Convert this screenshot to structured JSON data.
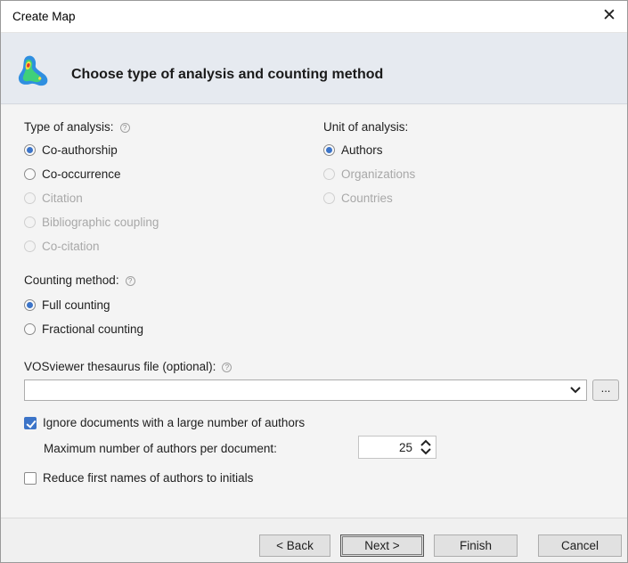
{
  "window": {
    "title": "Create Map",
    "close_glyph": "✕"
  },
  "header": {
    "title": "Choose type of analysis and counting method",
    "icon": "density-map-icon"
  },
  "type_of_analysis": {
    "label": "Type of analysis:",
    "options": [
      {
        "label": "Co-authorship",
        "selected": true,
        "enabled": true
      },
      {
        "label": "Co-occurrence",
        "selected": false,
        "enabled": true
      },
      {
        "label": "Citation",
        "selected": false,
        "enabled": false
      },
      {
        "label": "Bibliographic coupling",
        "selected": false,
        "enabled": false
      },
      {
        "label": "Co-citation",
        "selected": false,
        "enabled": false
      }
    ]
  },
  "unit_of_analysis": {
    "label": "Unit of analysis:",
    "options": [
      {
        "label": "Authors",
        "selected": true,
        "enabled": true
      },
      {
        "label": "Organizations",
        "selected": false,
        "enabled": false
      },
      {
        "label": "Countries",
        "selected": false,
        "enabled": false
      }
    ]
  },
  "counting_method": {
    "label": "Counting method:",
    "options": [
      {
        "label": "Full counting",
        "selected": true
      },
      {
        "label": "Fractional counting",
        "selected": false
      }
    ]
  },
  "thesaurus": {
    "label": "VOSviewer thesaurus file (optional):",
    "value": "",
    "browse_label": "..."
  },
  "ignore_docs": {
    "label": "Ignore documents with a large number of authors",
    "checked": true
  },
  "max_authors": {
    "label": "Maximum number of authors per document:",
    "value": "25"
  },
  "reduce_names": {
    "label": "Reduce first names of authors to initials",
    "checked": false
  },
  "buttons": {
    "back": "< Back",
    "next": "Next >",
    "finish": "Finish",
    "cancel": "Cancel"
  },
  "colors": {
    "accent": "#3c74c8",
    "header_bg": "#e6eaf0",
    "disabled_text": "#a8a8a8"
  }
}
